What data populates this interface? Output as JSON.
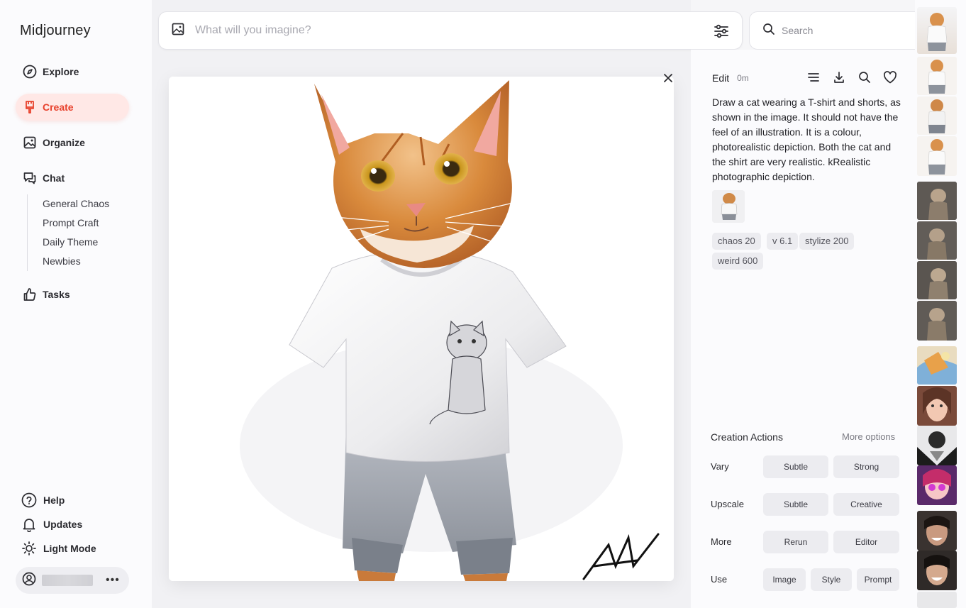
{
  "app": {
    "title": "Midjourney"
  },
  "sidebar": {
    "items": [
      {
        "label": "Explore",
        "icon": "compass-icon"
      },
      {
        "label": "Create",
        "icon": "brush-icon",
        "active": true
      },
      {
        "label": "Organize",
        "icon": "image-icon"
      },
      {
        "label": "Chat",
        "icon": "chat-icon"
      }
    ],
    "chat_channels": [
      "General Chaos",
      "Prompt Craft",
      "Daily Theme",
      "Newbies"
    ],
    "tasks": {
      "label": "Tasks",
      "icon": "thumbs-up-icon"
    },
    "bottom": [
      {
        "label": "Help",
        "icon": "help-circle-icon"
      },
      {
        "label": "Updates",
        "icon": "bell-icon"
      },
      {
        "label": "Light Mode",
        "icon": "sun-icon"
      }
    ],
    "user": {
      "more_label": "•••"
    }
  },
  "imagine": {
    "placeholder": "What will you imagine?"
  },
  "search": {
    "placeholder": "Search"
  },
  "detail": {
    "edit_label": "Edit",
    "time": "0m",
    "prompt": "Draw a cat wearing a T-shirt and shorts, as shown in the image. It should not have the feel of an illustration. It is a colour, photorealistic depiction. Both the cat and the shirt are very realistic. kRealistic photographic depiction.",
    "tags": [
      "chaos 20",
      "v 6.1",
      "stylize 200",
      "weird 600"
    ]
  },
  "actions": {
    "title": "Creation Actions",
    "more_options": "More options",
    "rows": [
      {
        "label": "Vary",
        "buttons": [
          "Subtle",
          "Strong"
        ]
      },
      {
        "label": "Upscale",
        "buttons": [
          "Subtle",
          "Creative"
        ]
      },
      {
        "label": "More",
        "buttons": [
          "Rerun",
          "Editor"
        ]
      },
      {
        "label": "Use",
        "buttons": [
          "Image",
          "Style",
          "Prompt"
        ]
      }
    ]
  },
  "colors": {
    "accent": "#e8412c",
    "accent_bg": "#ffe8e6"
  }
}
